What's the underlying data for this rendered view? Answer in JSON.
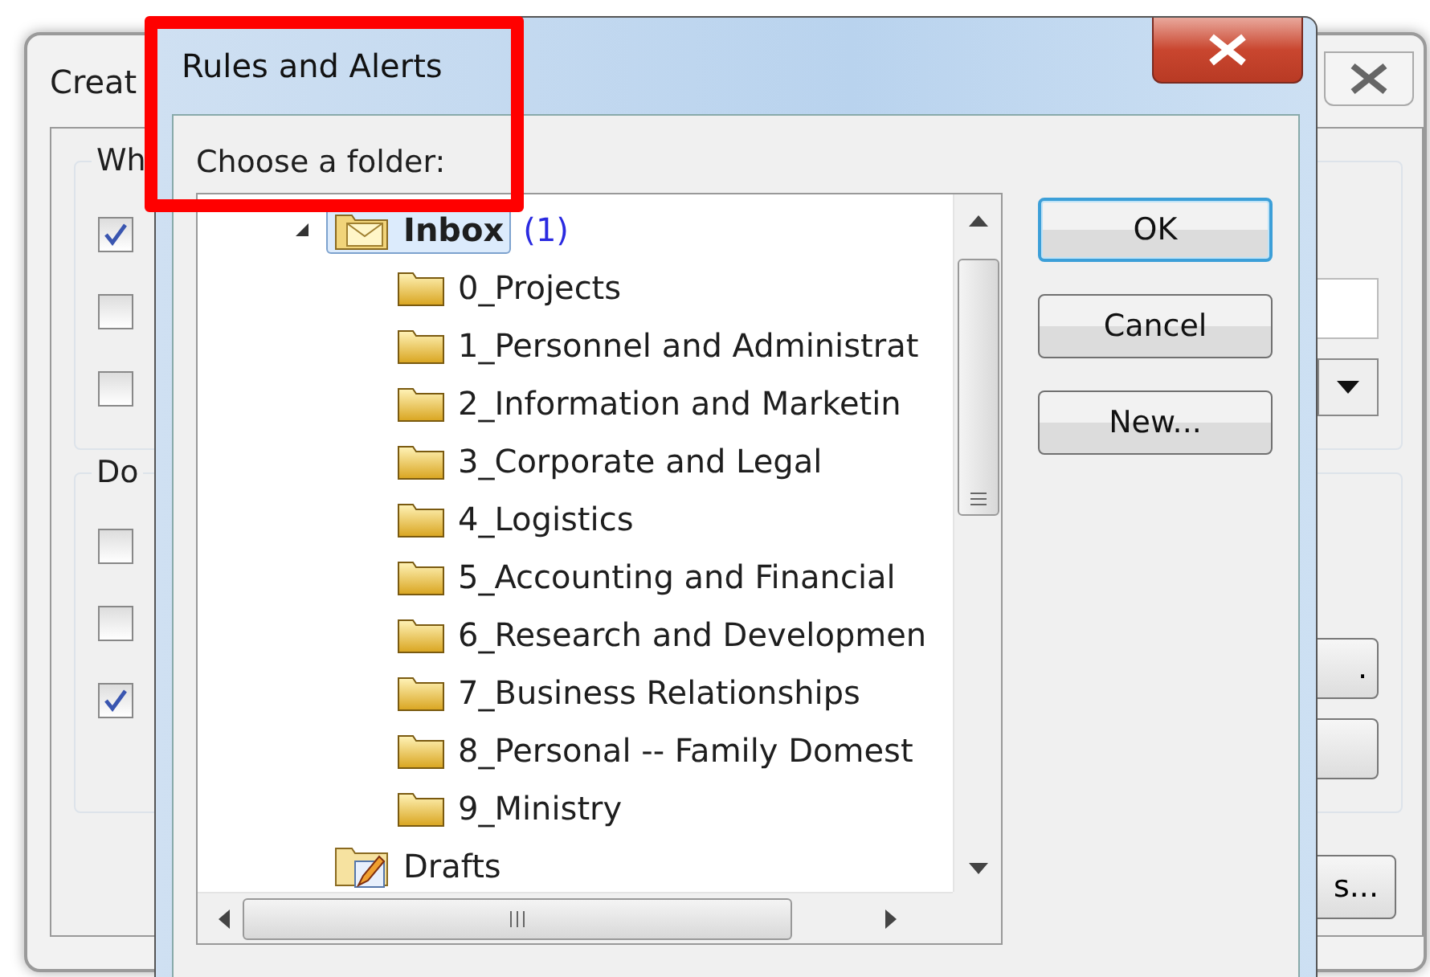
{
  "background_window": {
    "title": "Creat",
    "groups": [
      {
        "legend": "Wh",
        "checkboxes": [
          {
            "checked": true
          },
          {
            "checked": false
          },
          {
            "checked": false
          }
        ]
      },
      {
        "legend": "Do",
        "checkboxes": [
          {
            "checked": false
          },
          {
            "checked": false
          },
          {
            "checked": true
          }
        ]
      }
    ],
    "side_button": ".",
    "bottom_button": "s..."
  },
  "dialog": {
    "title": "Rules and Alerts",
    "prompt": "Choose a folder:",
    "tree": [
      {
        "label": "Inbox",
        "count": "(1)",
        "kind": "inbox",
        "selected": true,
        "expanded": true,
        "children": [
          {
            "label": "0_Projects",
            "kind": "folder",
            "selected": false
          },
          {
            "label": "1_Personnel and Administrat",
            "kind": "folder",
            "selected": false
          },
          {
            "label": "2_Information and Marketin",
            "kind": "folder",
            "selected": false
          },
          {
            "label": "3_Corporate and Legal",
            "kind": "folder",
            "selected": false
          },
          {
            "label": "4_Logistics",
            "kind": "folder",
            "selected": false
          },
          {
            "label": "5_Accounting and Financial",
            "kind": "folder",
            "selected": false
          },
          {
            "label": "6_Research and Developmen",
            "kind": "folder",
            "selected": false
          },
          {
            "label": "7_Business Relationships",
            "kind": "folder",
            "selected": false
          },
          {
            "label": "8_Personal -- Family Domest",
            "kind": "folder",
            "selected": false
          },
          {
            "label": "9_Ministry",
            "kind": "folder",
            "selected": false
          }
        ]
      },
      {
        "label": "Drafts",
        "kind": "drafts",
        "selected": false
      }
    ],
    "buttons": [
      {
        "label": "OK",
        "default": true
      },
      {
        "label": "Cancel",
        "default": false
      },
      {
        "label": "New...",
        "default": false
      }
    ]
  }
}
